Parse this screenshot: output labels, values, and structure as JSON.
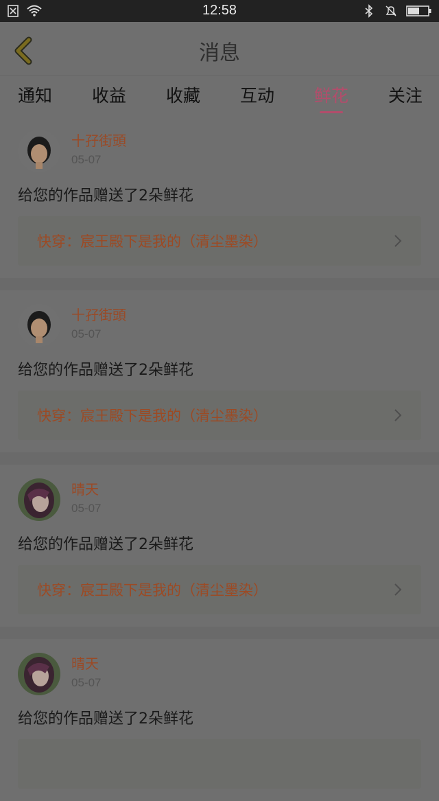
{
  "status_bar": {
    "time": "12:58"
  },
  "header": {
    "title": "消息"
  },
  "tabs": [
    {
      "label": "通知",
      "active": false
    },
    {
      "label": "收益",
      "active": false
    },
    {
      "label": "收藏",
      "active": false
    },
    {
      "label": "互动",
      "active": false
    },
    {
      "label": "鲜花",
      "active": true
    },
    {
      "label": "关注",
      "active": false
    }
  ],
  "items": [
    {
      "user": "十孖街頭",
      "date": "05-07",
      "message": "给您的作品赠送了2朵鲜花",
      "work": "快穿：宸王殿下是我的（清尘墨染）"
    },
    {
      "user": "十孖街頭",
      "date": "05-07",
      "message": "给您的作品赠送了2朵鲜花",
      "work": "快穿：宸王殿下是我的（清尘墨染）"
    },
    {
      "user": "晴天",
      "date": "05-07",
      "message": "给您的作品赠送了2朵鲜花",
      "work": "快穿：宸王殿下是我的（清尘墨染）"
    },
    {
      "user": "晴天",
      "date": "05-07",
      "message": "给您的作品赠送了2朵鲜花",
      "work": ""
    }
  ],
  "colors": {
    "accent": "#b24d6b",
    "username": "#9a4a26",
    "work_title": "#9c4a24"
  }
}
